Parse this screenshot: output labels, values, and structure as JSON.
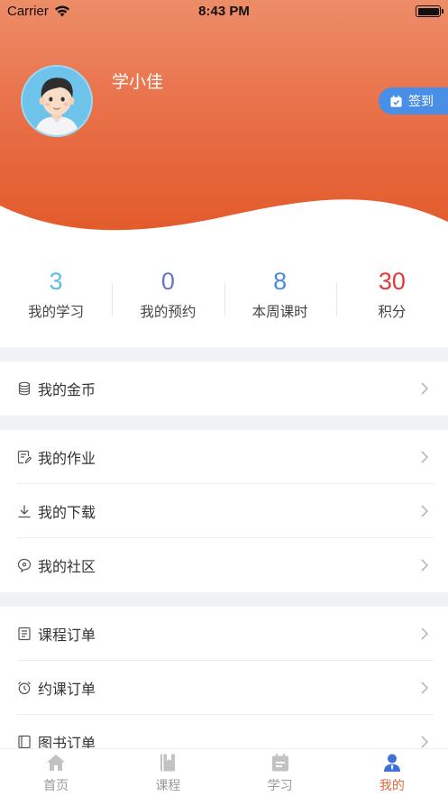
{
  "status_bar": {
    "carrier": "Carrier",
    "time": "8:43 PM"
  },
  "profile": {
    "name": "学小佳",
    "checkin_label": "签到"
  },
  "stats": [
    {
      "value": "3",
      "label": "我的学习",
      "color": "#5bbde4"
    },
    {
      "value": "0",
      "label": "我的预约",
      "color": "#6a78c2"
    },
    {
      "value": "8",
      "label": "本周课时",
      "color": "#4a8be0"
    },
    {
      "value": "30",
      "label": "积分",
      "color": "#e23a3a"
    }
  ],
  "menu": {
    "coins": {
      "label": "我的金币",
      "icon": "coins-icon"
    },
    "homework": {
      "label": "我的作业",
      "icon": "edit-note-icon"
    },
    "download": {
      "label": "我的下载",
      "icon": "download-icon"
    },
    "community": {
      "label": "我的社区",
      "icon": "chat-bubble-icon"
    },
    "course_orders": {
      "label": "课程订单",
      "icon": "list-doc-icon"
    },
    "booking_orders": {
      "label": "约课订单",
      "icon": "alarm-clock-icon"
    },
    "book_orders": {
      "label": "图书订单",
      "icon": "book-icon"
    }
  },
  "tabs": [
    {
      "label": "首页",
      "icon": "home-icon"
    },
    {
      "label": "课程",
      "icon": "book-icon"
    },
    {
      "label": "学习",
      "icon": "calendar-icon"
    },
    {
      "label": "我的",
      "icon": "user-icon",
      "active": true
    }
  ],
  "colors": {
    "header_top": "#ec8d68",
    "header_bottom": "#e25a2a",
    "accent": "#e26a3d",
    "checkin_bg": "#4a8fe7"
  }
}
